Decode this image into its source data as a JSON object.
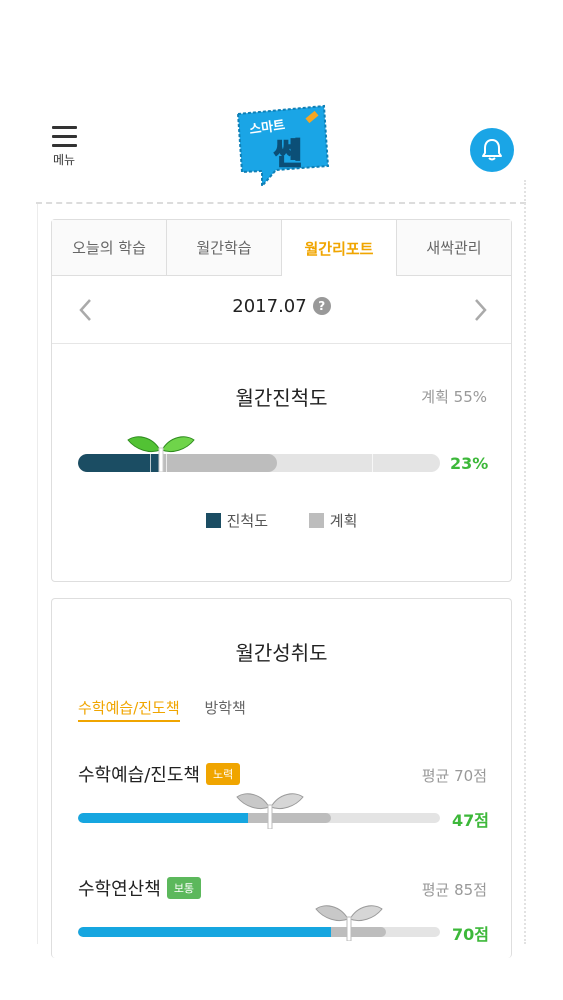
{
  "header": {
    "menu_label": "메뉴",
    "logo_text_top": "스마트",
    "logo_text_main": "쎈"
  },
  "tabs": [
    {
      "label": "오늘의 학습",
      "active": false
    },
    {
      "label": "월간학습",
      "active": false
    },
    {
      "label": "월간리포트",
      "active": true
    },
    {
      "label": "새싹관리",
      "active": false
    }
  ],
  "month": {
    "value": "2017.07",
    "help": "?"
  },
  "monthly_progress": {
    "title": "월간진척도",
    "plan_label": "계획 55%",
    "progress_percent": 23,
    "plan_percent": 55,
    "progress_label": "23%",
    "legend": [
      {
        "label": "진척도",
        "color": "#1b4d63"
      },
      {
        "label": "계획",
        "color": "#bdbdbd"
      }
    ]
  },
  "achievement": {
    "title": "월간성취도",
    "subtabs": [
      {
        "label": "수학예습/진도책",
        "active": true
      },
      {
        "label": "방학책",
        "active": false
      }
    ],
    "rows": [
      {
        "title": "수학예습/진도책",
        "badge": "노력",
        "badge_color": "#f0a500",
        "avg_label": "평균 70점",
        "avg": 70,
        "score": 47,
        "score_label": "47점"
      },
      {
        "title": "수학연산책",
        "badge": "보통",
        "badge_color": "#5cb85c",
        "avg_label": "평균 85점",
        "avg": 85,
        "score": 70,
        "score_label": "70점"
      }
    ]
  },
  "colors": {
    "accent": "#f0a500",
    "green": "#3db83a",
    "blue": "#16a6e0",
    "dark": "#1b4d63"
  }
}
